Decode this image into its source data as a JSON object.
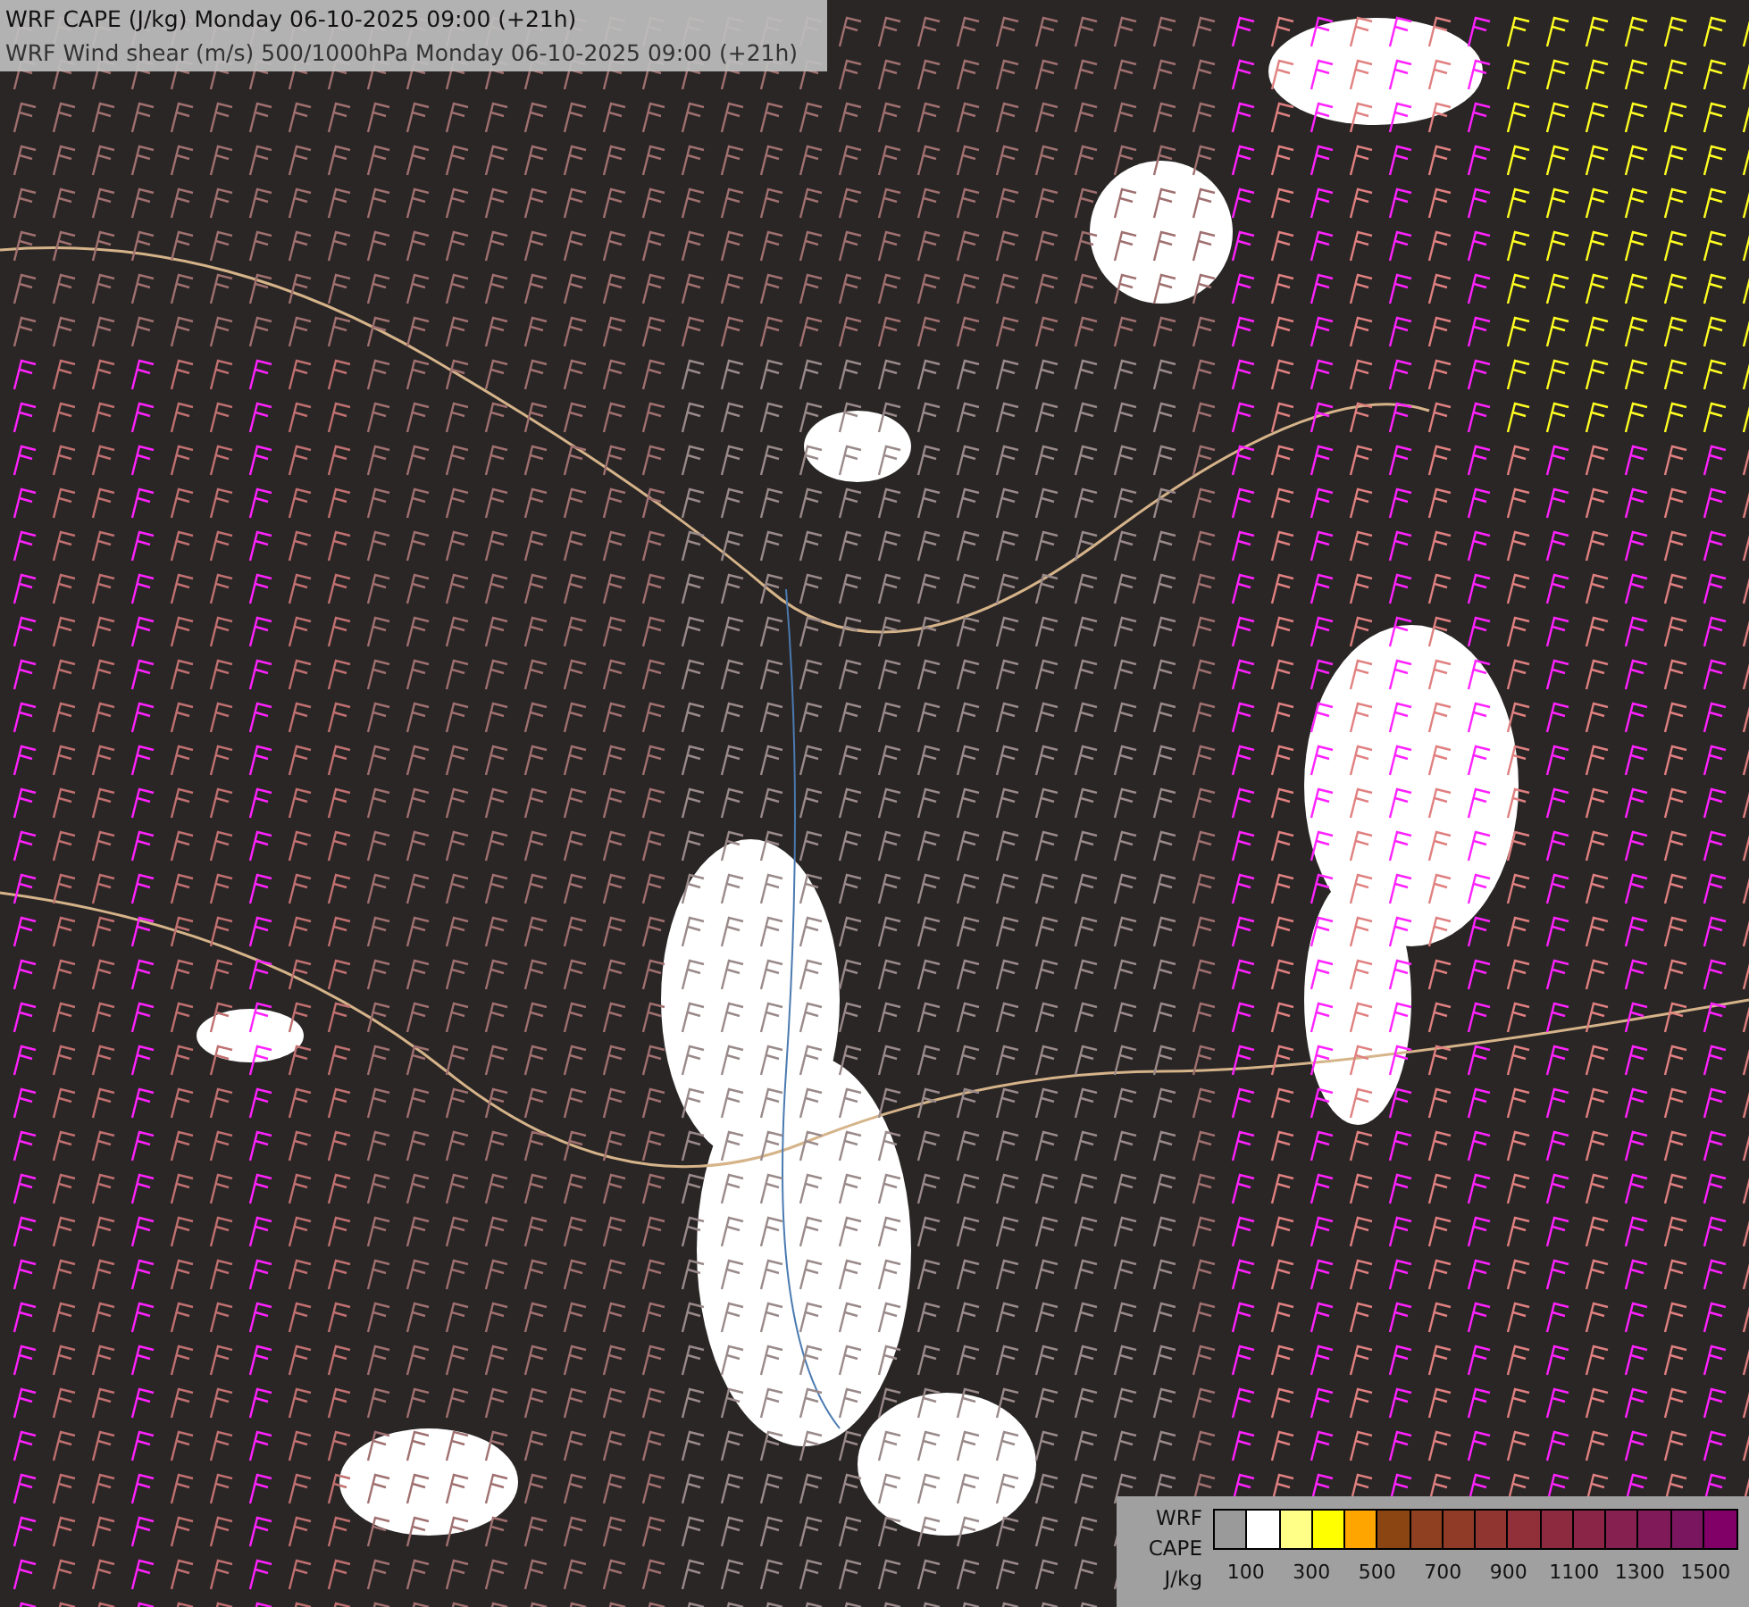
{
  "header": {
    "lines": [
      "WRF CAPE (J/kg) Monday 06-10-2025 09:00 (+21h)",
      "WRF Wind shear (m/s) 500/1000hPa Monday 06-10-2025 09:00 (+21h)"
    ]
  },
  "legend": {
    "labels": [
      "WRF",
      "CAPE",
      "J/kg"
    ],
    "swatches": [
      {
        "color": "#9a9a9a"
      },
      {
        "color": "#ffffff"
      },
      {
        "color": "#ffff88"
      },
      {
        "color": "#ffff00"
      },
      {
        "color": "#ffa500"
      },
      {
        "color": "#8b4513"
      },
      {
        "color": "#8e4020"
      },
      {
        "color": "#903a28"
      },
      {
        "color": "#913530"
      },
      {
        "color": "#913038"
      },
      {
        "color": "#8e2a40"
      },
      {
        "color": "#8a2548"
      },
      {
        "color": "#862050"
      },
      {
        "color": "#801a58"
      },
      {
        "color": "#7a1560"
      },
      {
        "color": "#800068"
      }
    ],
    "ticks": [
      "100",
      "300",
      "500",
      "700",
      "900",
      "1100",
      "1300",
      "1500"
    ]
  }
}
